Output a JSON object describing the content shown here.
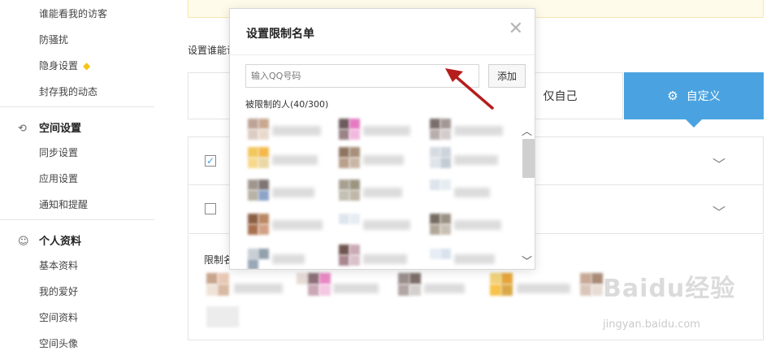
{
  "sidebar": {
    "items_top": [
      "谁能看我的访客",
      "防骚扰",
      "隐身设置",
      "封存我的动态"
    ],
    "diamond_icon": "diamond-icon",
    "section_space": {
      "title": "空间设置",
      "icon": "space-settings-icon"
    },
    "items_space": [
      "同步设置",
      "应用设置",
      "通知和提醒"
    ],
    "section_profile": {
      "title": "个人资料",
      "icon": "profile-icon"
    },
    "items_profile": [
      "基本资料",
      "我的爱好",
      "空间资料",
      "空间头像"
    ]
  },
  "main": {
    "set_label": "设置谁能访",
    "options": {
      "self_only": "仅自己",
      "custom": "自定义"
    },
    "rows": [
      {
        "checked": true
      },
      {
        "checked": false
      }
    ],
    "limit_label": "限制名"
  },
  "dialog": {
    "title": "设置限制名单",
    "close_icon": "close-icon",
    "input_placeholder": "输入QQ号码",
    "add_label": "添加",
    "count_label": "被限制的人(40/300)"
  },
  "watermark": {
    "logo": "Baidu经验",
    "url": "jingyan.baidu.com"
  },
  "colors": {
    "accent": "#4aa3e0",
    "arrow": "#b51d1d",
    "notice_bg": "#fffbea"
  }
}
